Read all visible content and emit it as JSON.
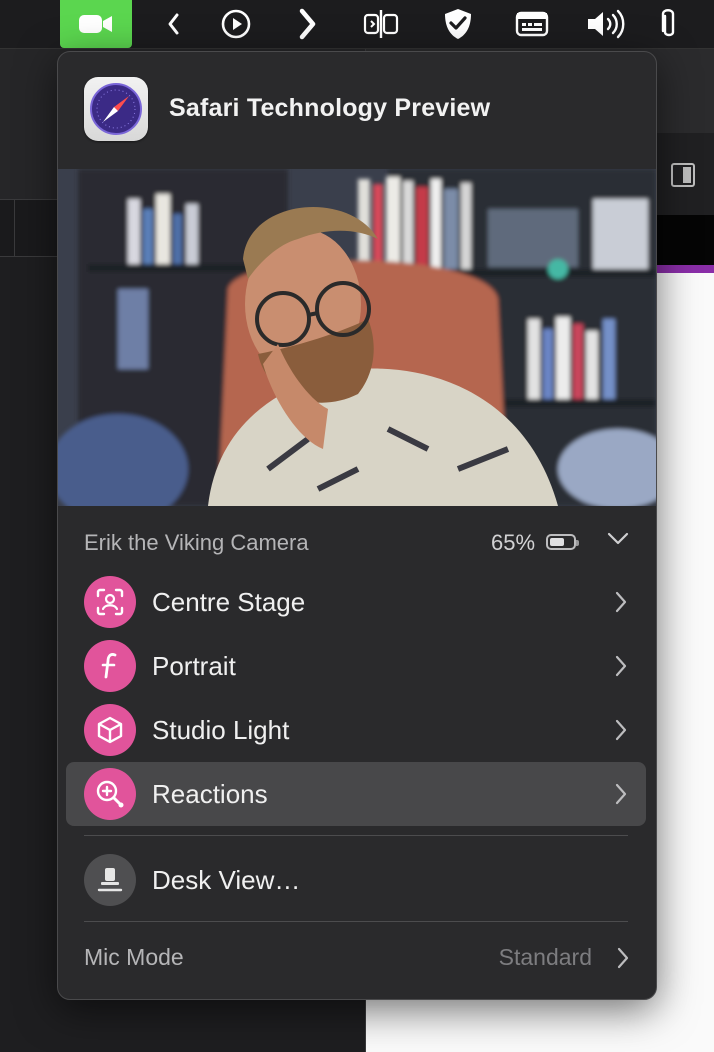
{
  "menubar": {
    "icons": [
      "video-camera-icon",
      "back-icon",
      "play-icon",
      "forward-icon",
      "split-view-icon",
      "shield-check-icon",
      "keyboard-icon",
      "speaker-icon",
      "paperclip-icon"
    ]
  },
  "panel": {
    "app_name": "Safari Technology Preview",
    "camera": {
      "name": "Erik the Viking Camera",
      "battery": "65%",
      "battery_level": 0.65
    },
    "menu_items": [
      {
        "label": "Centre Stage",
        "icon": "centre-stage-icon",
        "accent": "#e1549b"
      },
      {
        "label": "Portrait",
        "icon": "portrait-f-icon",
        "accent": "#e1549b"
      },
      {
        "label": "Studio Light",
        "icon": "cube-icon",
        "accent": "#e1549b"
      },
      {
        "label": "Reactions",
        "icon": "reactions-icon",
        "accent": "#e1549b"
      }
    ],
    "desk_view": {
      "label": "Desk View…",
      "icon": "desk-view-icon"
    },
    "mic_mode": {
      "label": "Mic Mode",
      "value": "Standard"
    }
  },
  "colors": {
    "camera_active": "#5bd64f",
    "accent_pink": "#e1549b",
    "highlight": "#48484a"
  }
}
